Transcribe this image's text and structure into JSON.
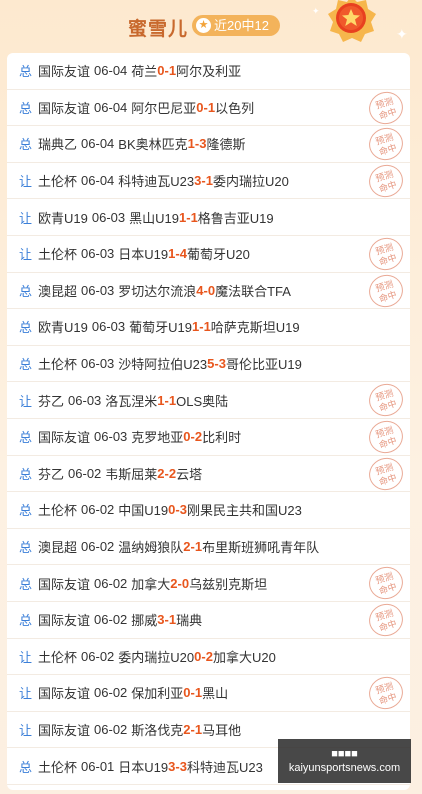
{
  "header": {
    "title": "蜜雪儿",
    "record": "近20中12",
    "star_icon": "star-icon",
    "medal_icon": "medal-icon"
  },
  "colors": {
    "accent": "#e8561d",
    "type_blue": "#3b7fd8",
    "title": "#c8692d"
  },
  "stamp": {
    "line1": "预测",
    "line2": "命中"
  },
  "rows": [
    {
      "type": "总",
      "league": "国际友谊",
      "date": "06-04",
      "home": "荷兰",
      "hs": "0",
      "as": "1",
      "away": "阿尔及利亚",
      "hit": false
    },
    {
      "type": "总",
      "league": "国际友谊",
      "date": "06-04",
      "home": "阿尔巴尼亚",
      "hs": "0",
      "as": "1",
      "away": "以色列",
      "hit": true
    },
    {
      "type": "总",
      "league": "瑞典乙",
      "date": "06-04",
      "home": "BK奥林匹克",
      "hs": "1",
      "as": "3",
      "away": "隆德斯",
      "hit": true
    },
    {
      "type": "让",
      "league": "土伦杯",
      "date": "06-04",
      "home": "科特迪瓦U23",
      "hs": "3",
      "as": "1",
      "away": "委内瑞拉U20",
      "hit": true
    },
    {
      "type": "让",
      "league": "欧青U19",
      "date": "06-03",
      "home": "黑山U19",
      "hs": "1",
      "as": "1",
      "away": "格鲁吉亚U19",
      "hit": false
    },
    {
      "type": "让",
      "league": "土伦杯",
      "date": "06-03",
      "home": "日本U19",
      "hs": "1",
      "as": "4",
      "away": "葡萄牙U20",
      "hit": true
    },
    {
      "type": "总",
      "league": "澳昆超",
      "date": "06-03",
      "home": "罗切达尔流浪",
      "hs": "4",
      "as": "0",
      "away": "魔法联合TFA",
      "hit": true
    },
    {
      "type": "总",
      "league": "欧青U19",
      "date": "06-03",
      "home": "葡萄牙U19",
      "hs": "1",
      "as": "1",
      "away": "哈萨克斯坦U19",
      "hit": false
    },
    {
      "type": "总",
      "league": "土伦杯",
      "date": "06-03",
      "home": "沙特阿拉伯U23",
      "hs": "5",
      "as": "3",
      "away": "哥伦比亚U19",
      "hit": false
    },
    {
      "type": "让",
      "league": "芬乙",
      "date": "06-03",
      "home": "洛瓦涅米",
      "hs": "1",
      "as": "1",
      "away": "OLS奥陆",
      "hit": true
    },
    {
      "type": "总",
      "league": "国际友谊",
      "date": "06-03",
      "home": "克罗地亚",
      "hs": "0",
      "as": "2",
      "away": "比利时",
      "hit": true
    },
    {
      "type": "总",
      "league": "芬乙",
      "date": "06-02",
      "home": "韦斯屈莱",
      "hs": "2",
      "as": "2",
      "away": "云塔",
      "hit": true
    },
    {
      "type": "总",
      "league": "土伦杯",
      "date": "06-02",
      "home": "中国U19",
      "hs": "0",
      "as": "3",
      "away": "刚果民主共和国U23",
      "hit": false
    },
    {
      "type": "总",
      "league": "澳昆超",
      "date": "06-02",
      "home": "温纳姆狼队",
      "hs": "2",
      "as": "1",
      "away": "布里斯班狮吼青年队",
      "hit": false
    },
    {
      "type": "总",
      "league": "国际友谊",
      "date": "06-02",
      "home": "加拿大",
      "hs": "2",
      "as": "0",
      "away": "乌兹别克斯坦",
      "hit": true
    },
    {
      "type": "总",
      "league": "国际友谊",
      "date": "06-02",
      "home": "挪威",
      "hs": "3",
      "as": "1",
      "away": "瑞典",
      "hit": true
    },
    {
      "type": "让",
      "league": "土伦杯",
      "date": "06-02",
      "home": "委内瑞拉U20",
      "hs": "0",
      "as": "2",
      "away": "加拿大U20",
      "hit": false
    },
    {
      "type": "让",
      "league": "国际友谊",
      "date": "06-02",
      "home": "保加利亚",
      "hs": "0",
      "as": "1",
      "away": "黑山",
      "hit": true
    },
    {
      "type": "让",
      "league": "国际友谊",
      "date": "06-02",
      "home": "斯洛伐克",
      "hs": "2",
      "as": "1",
      "away": "马耳他",
      "hit": false
    },
    {
      "type": "总",
      "league": "土伦杯",
      "date": "06-01",
      "home": "日本U19",
      "hs": "3",
      "as": "3",
      "away": "科特迪瓦U23",
      "hit": false
    }
  ],
  "watermark": {
    "line1": "■■■■",
    "line2": "kaiyunsportsnews.com"
  }
}
